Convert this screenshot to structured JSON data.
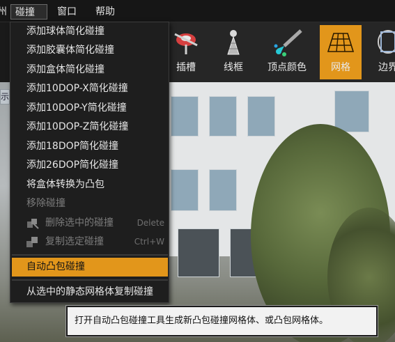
{
  "menubar": {
    "partial_left": "州",
    "items": [
      {
        "label": "碰撞",
        "active": true
      },
      {
        "label": "窗口"
      },
      {
        "label": "帮助"
      }
    ]
  },
  "toolbar": {
    "items": [
      {
        "label": "插槽",
        "icon": "socket-icon"
      },
      {
        "label": "线框",
        "icon": "wireframe-icon"
      },
      {
        "label": "顶点颜色",
        "icon": "vertex-color-icon"
      },
      {
        "label": "网格",
        "icon": "grid-icon",
        "selected": true
      },
      {
        "label": "边界",
        "icon": "bounds-icon"
      }
    ],
    "accent": "#e2961b"
  },
  "viewport": {
    "tab_label": "示"
  },
  "collision_menu": {
    "items": [
      {
        "label": "添加球体简化碰撞"
      },
      {
        "label": "添加胶囊体简化碰撞"
      },
      {
        "label": "添加盒体简化碰撞"
      },
      {
        "label": "添加10DOP-X简化碰撞"
      },
      {
        "label": "添加10DOP-Y简化碰撞"
      },
      {
        "label": "添加10DOP-Z简化碰撞"
      },
      {
        "label": "添加18DOP简化碰撞"
      },
      {
        "label": "添加26DOP简化碰撞"
      },
      {
        "label": "将盒体转换为凸包"
      },
      {
        "label": "移除碰撞",
        "disabled": true
      },
      {
        "label": "删除选中的碰撞",
        "disabled": true,
        "shortcut": "Delete",
        "icon": "delete-collision-icon"
      },
      {
        "label": "复制选定碰撞",
        "disabled": true,
        "shortcut": "Ctrl+W",
        "icon": "duplicate-collision-icon"
      },
      {
        "label": "自动凸包碰撞",
        "highlighted": true
      },
      {
        "label": "从选中的静态网格体复制碰撞"
      }
    ]
  },
  "tooltip": {
    "text": "打开自动凸包碰撞工具生成新凸包碰撞网格体、或凸包网格体。"
  }
}
